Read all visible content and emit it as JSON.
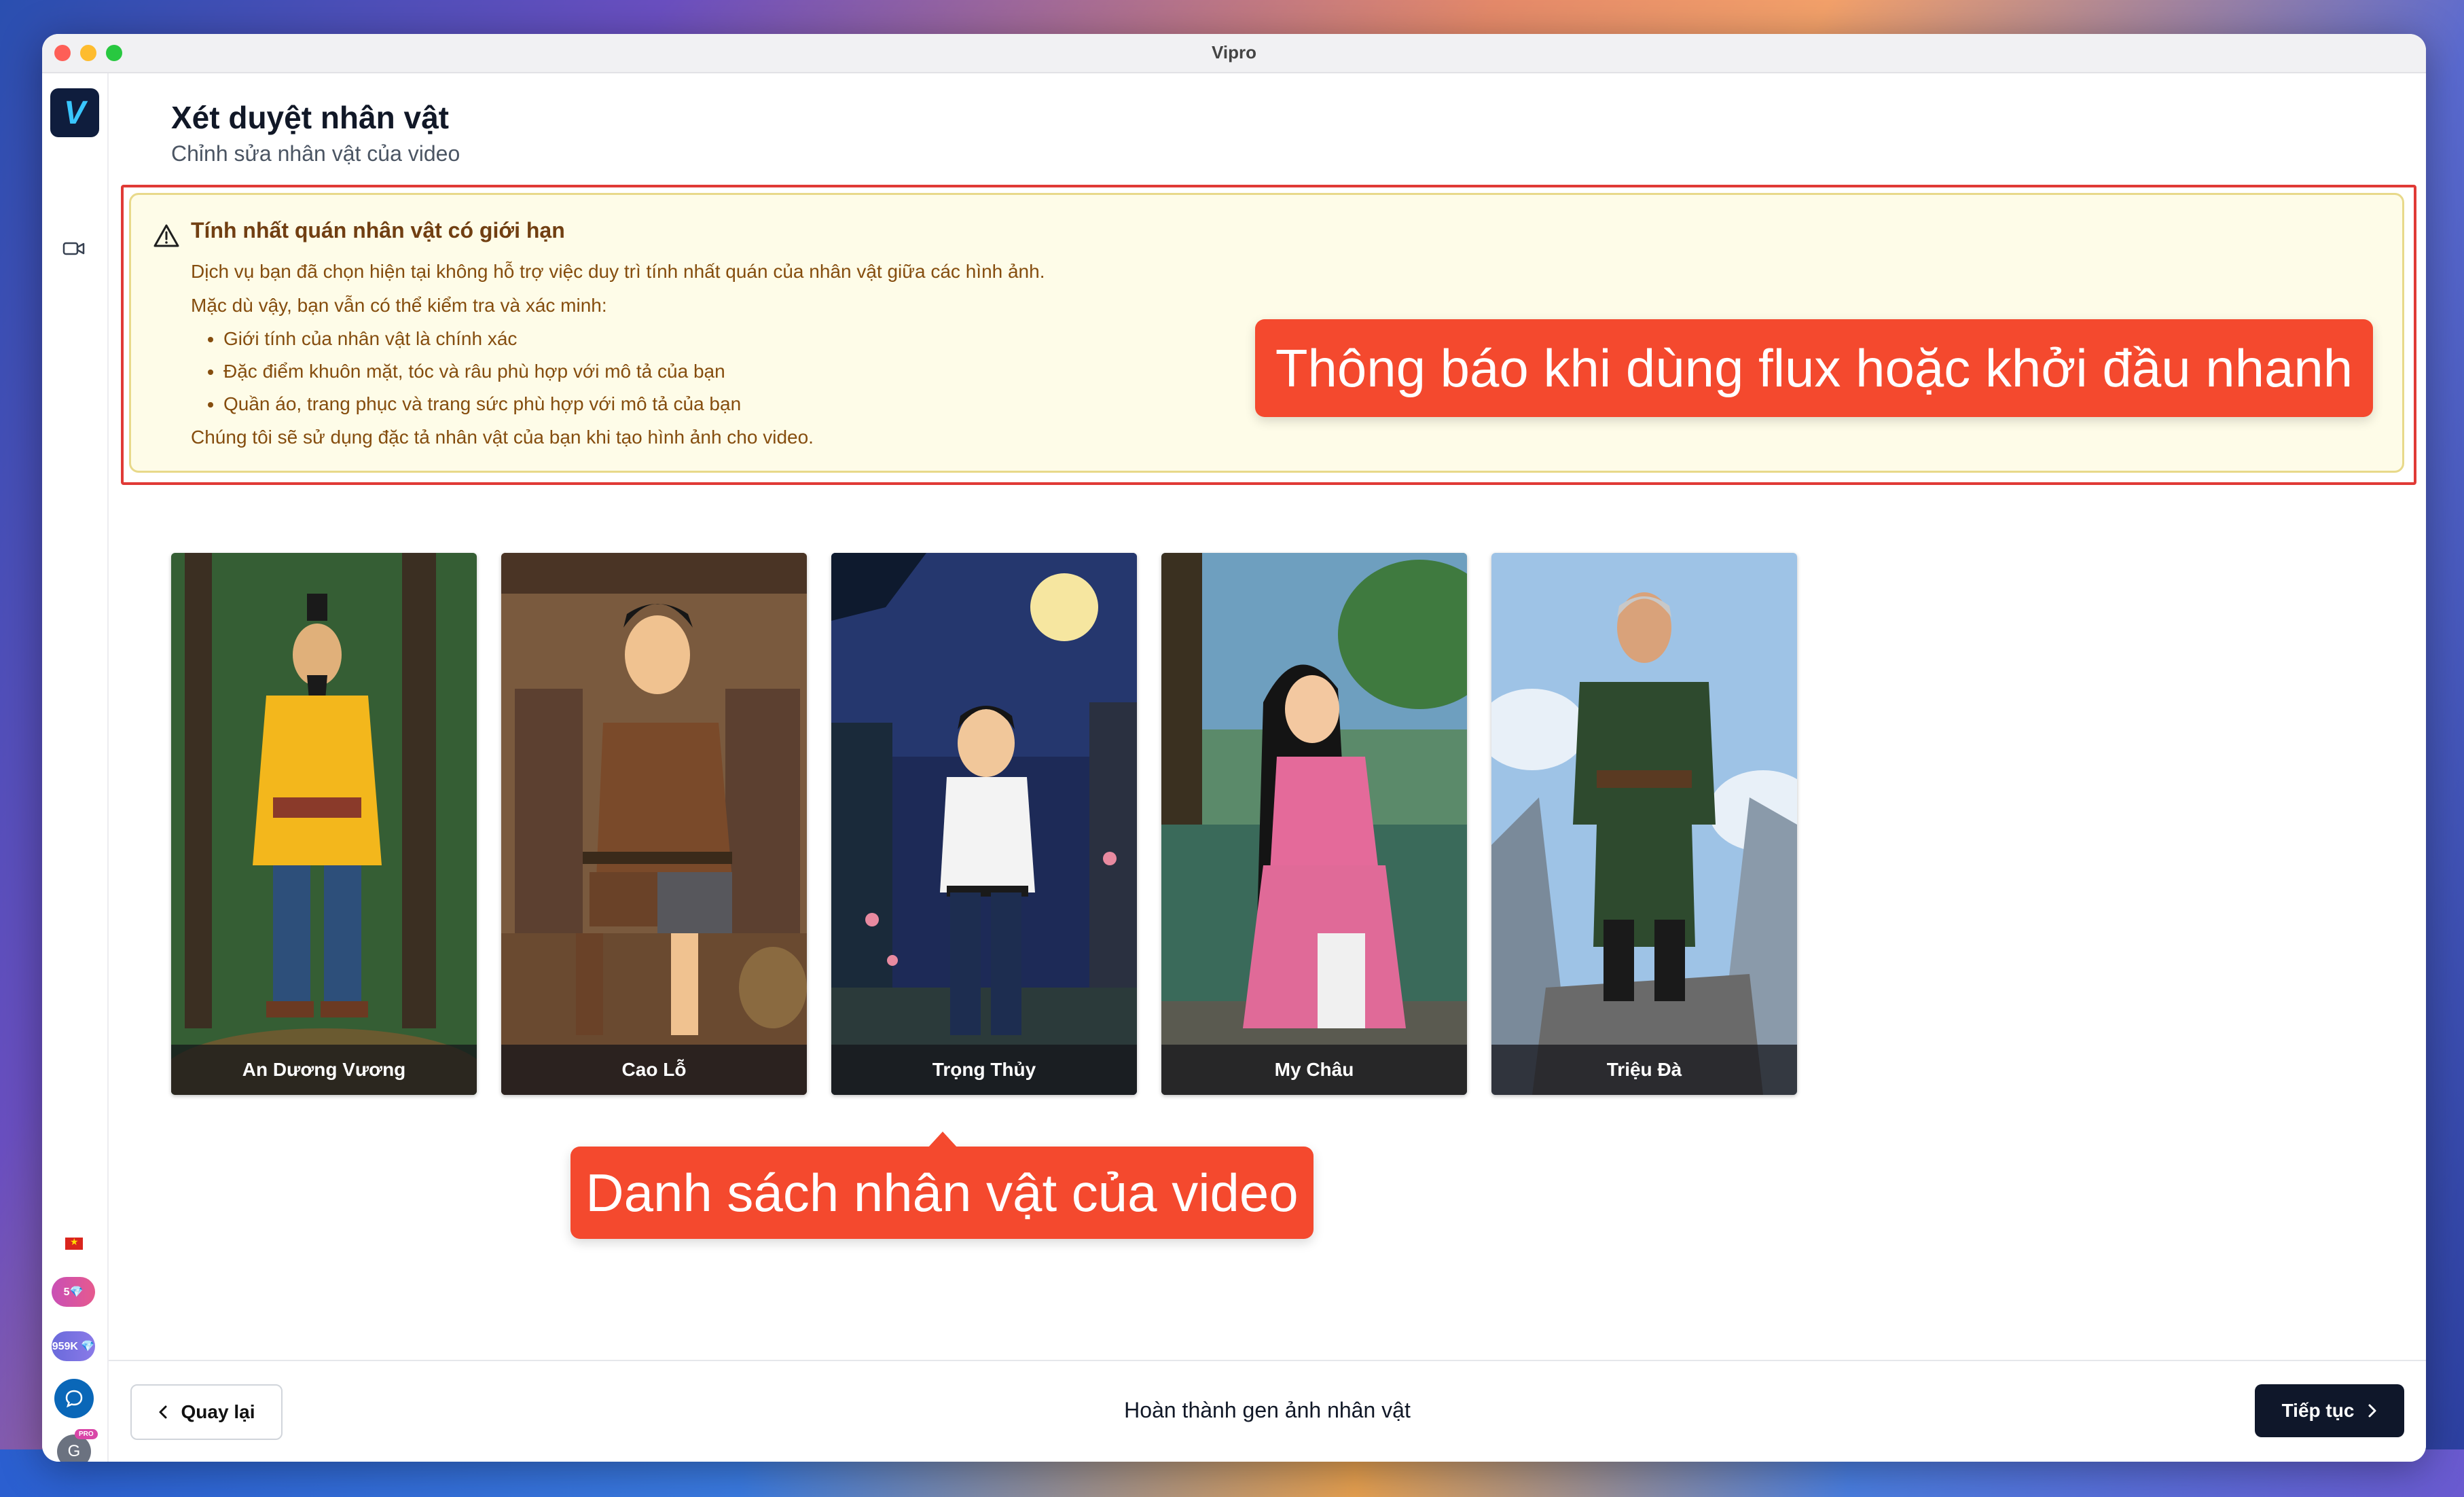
{
  "window": {
    "title": "Vipro"
  },
  "sidebar": {
    "logo": "V",
    "credits_1": "5💎",
    "credits_2": "959K 💎",
    "avatar": "G",
    "pro_badge": "PRO"
  },
  "header": {
    "title": "Xét duyệt nhân vật",
    "subtitle": "Chỉnh sửa nhân vật của video"
  },
  "warning": {
    "title": "Tính nhất quán nhân vật có giới hạn",
    "line1": "Dịch vụ bạn đã chọn hiện tại không hỗ trợ việc duy trì tính nhất quán của nhân vật giữa các hình ảnh.",
    "line2": "Mặc dù vậy, bạn vẫn có thể kiểm tra và xác minh:",
    "bullets": [
      "Giới tính của nhân vật là chính xác",
      "Đặc điểm khuôn mặt, tóc và râu phù hợp với mô tả của bạn",
      "Quần áo, trang phục và trang sức phù hợp với mô tả của bạn"
    ],
    "line3": "Chúng tôi sẽ sử dụng đặc tả nhân vật của bạn khi tạo hình ảnh cho video."
  },
  "annotations": {
    "warning_callout": "Thông báo khi dùng flux hoặc khởi đầu nhanh",
    "list_callout": "Danh sách nhân vật của video"
  },
  "characters": [
    {
      "name": "An Dương Vương"
    },
    {
      "name": "Cao Lỗ"
    },
    {
      "name": "Trọng Thủy"
    },
    {
      "name": "My Châu"
    },
    {
      "name": "Triệu Đà"
    }
  ],
  "footer": {
    "back_label": "Quay lại",
    "status": "Hoàn thành gen ảnh nhân vật",
    "next_label": "Tiếp tục"
  }
}
